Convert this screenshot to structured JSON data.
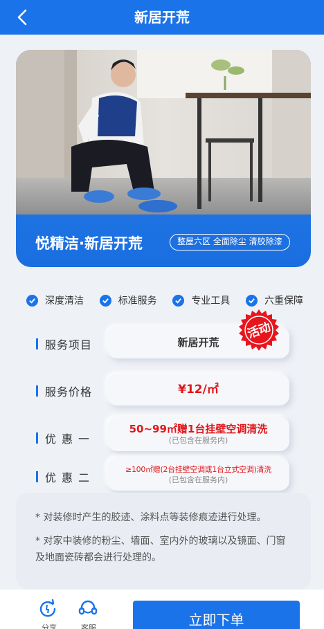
{
  "header": {
    "title": "新居开荒",
    "back_icon": "chevron-left-icon"
  },
  "hero": {
    "name": "悦精洁·新居开荒",
    "tag": "整屋六区 全面除尘 清胶除漆"
  },
  "features": [
    {
      "label": "深度清洁",
      "icon": "check-circle-icon"
    },
    {
      "label": "标准服务",
      "icon": "check-circle-icon"
    },
    {
      "label": "专业工具",
      "icon": "check-circle-icon"
    },
    {
      "label": "六重保障",
      "icon": "check-circle-icon"
    }
  ],
  "rows": {
    "project": {
      "label": "服务项目",
      "value": "新居开荒",
      "stamp": "活动"
    },
    "price": {
      "label": "服务价格",
      "value": "¥12/㎡"
    },
    "promo1": {
      "label": "优惠一",
      "value": "50~99㎡赠1台挂壁空调清洗",
      "note": "(已包含在服务内)"
    },
    "promo2": {
      "label": "优惠二",
      "value": "≥100㎡赠(2台挂壁空调或1台立式空调)清洗",
      "note": "(已包含在服务内)"
    }
  },
  "notes": [
    "* 对装修时产生的胶迹、涂料点等装修痕迹进行处理。",
    "* 对家中装修的粉尘、墙面、室内外的玻璃以及镜面、门窗及地面瓷砖都会进行处理的。"
  ],
  "bottom": {
    "share_icon": "share-icon",
    "service_icon": "headset-icon",
    "share_label": "分享",
    "service_label": "客服",
    "order_label": "立即下单"
  },
  "colors": {
    "primary": "#1a73e8",
    "promo_red": "#e0171b",
    "stamp_red": "#e8151c"
  }
}
